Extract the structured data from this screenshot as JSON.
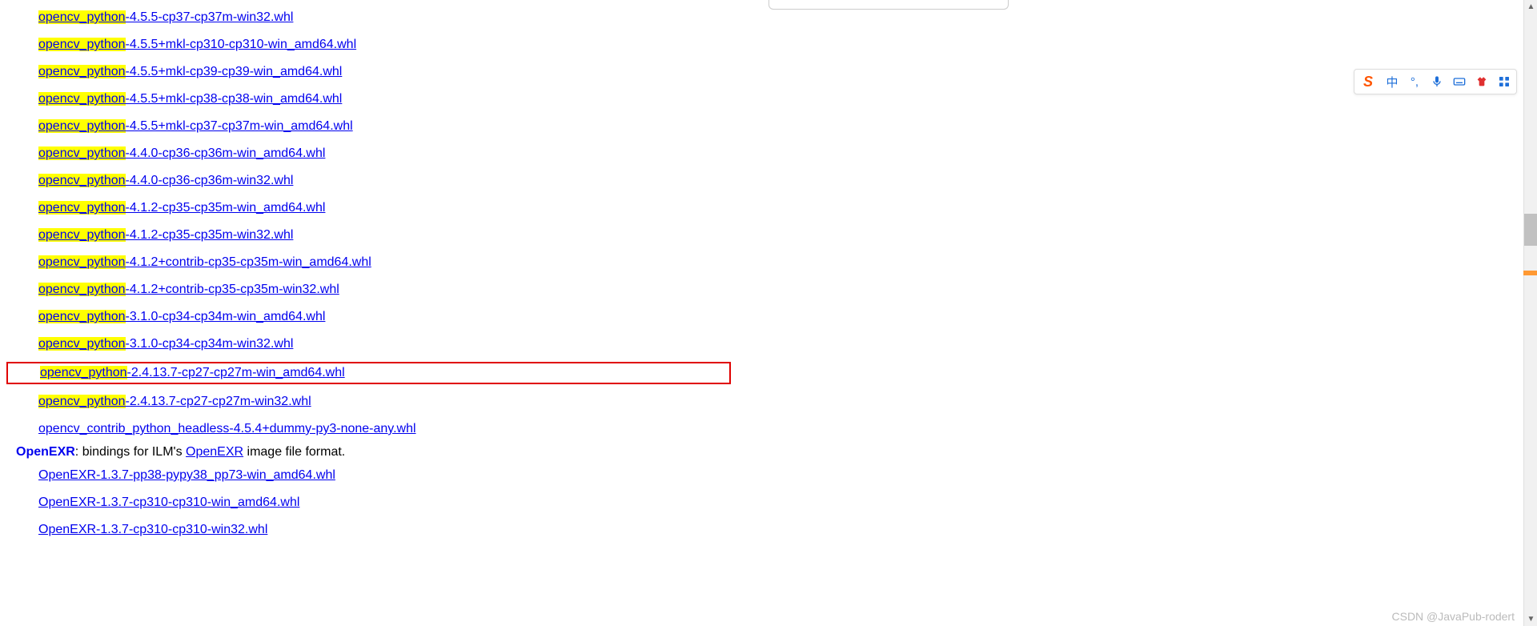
{
  "highlight_prefix": "opencv_python",
  "opencv_links": [
    {
      "suffix": "-4.5.5-cp37-cp37m-win32.whl",
      "hl": true,
      "boxed": false
    },
    {
      "suffix": "-4.5.5+mkl-cp310-cp310-win_amd64.whl",
      "hl": true,
      "boxed": false
    },
    {
      "suffix": "-4.5.5+mkl-cp39-cp39-win_amd64.whl",
      "hl": true,
      "boxed": false
    },
    {
      "suffix": "-4.5.5+mkl-cp38-cp38-win_amd64.whl",
      "hl": true,
      "boxed": false
    },
    {
      "suffix": "-4.5.5+mkl-cp37-cp37m-win_amd64.whl",
      "hl": true,
      "boxed": false
    },
    {
      "suffix": "-4.4.0-cp36-cp36m-win_amd64.whl",
      "hl": true,
      "boxed": false
    },
    {
      "suffix": "-4.4.0-cp36-cp36m-win32.whl",
      "hl": true,
      "boxed": false
    },
    {
      "suffix": "-4.1.2-cp35-cp35m-win_amd64.whl",
      "hl": true,
      "boxed": false
    },
    {
      "suffix": "-4.1.2-cp35-cp35m-win32.whl",
      "hl": true,
      "boxed": false
    },
    {
      "suffix": "-4.1.2+contrib-cp35-cp35m-win_amd64.whl",
      "hl": true,
      "boxed": false
    },
    {
      "suffix": "-4.1.2+contrib-cp35-cp35m-win32.whl",
      "hl": true,
      "boxed": false
    },
    {
      "suffix": "-3.1.0-cp34-cp34m-win_amd64.whl",
      "hl": true,
      "boxed": false
    },
    {
      "suffix": "-3.1.0-cp34-cp34m-win32.whl",
      "hl": true,
      "boxed": false
    },
    {
      "suffix": "-2.4.13.7-cp27-cp27m-win_amd64.whl",
      "hl": true,
      "boxed": true
    },
    {
      "suffix": "-2.4.13.7-cp27-cp27m-win32.whl",
      "hl": true,
      "boxed": false
    }
  ],
  "contrib_link": "opencv_contrib_python_headless-4.5.4+dummy-py3-none-any.whl",
  "openexr_section": {
    "title_prefix": "OpenEXR",
    "desc_part1": ": bindings for ILM's ",
    "link_text": "OpenEXR",
    "desc_part2": " image file format."
  },
  "openexr_links": [
    "OpenEXR-1.3.7-pp38-pypy38_pp73-win_amd64.whl",
    "OpenEXR-1.3.7-cp310-cp310-win_amd64.whl",
    "OpenEXR-1.3.7-cp310-cp310-win32.whl"
  ],
  "ime": {
    "lang": "中"
  },
  "watermark": "CSDN @JavaPub-rodert"
}
